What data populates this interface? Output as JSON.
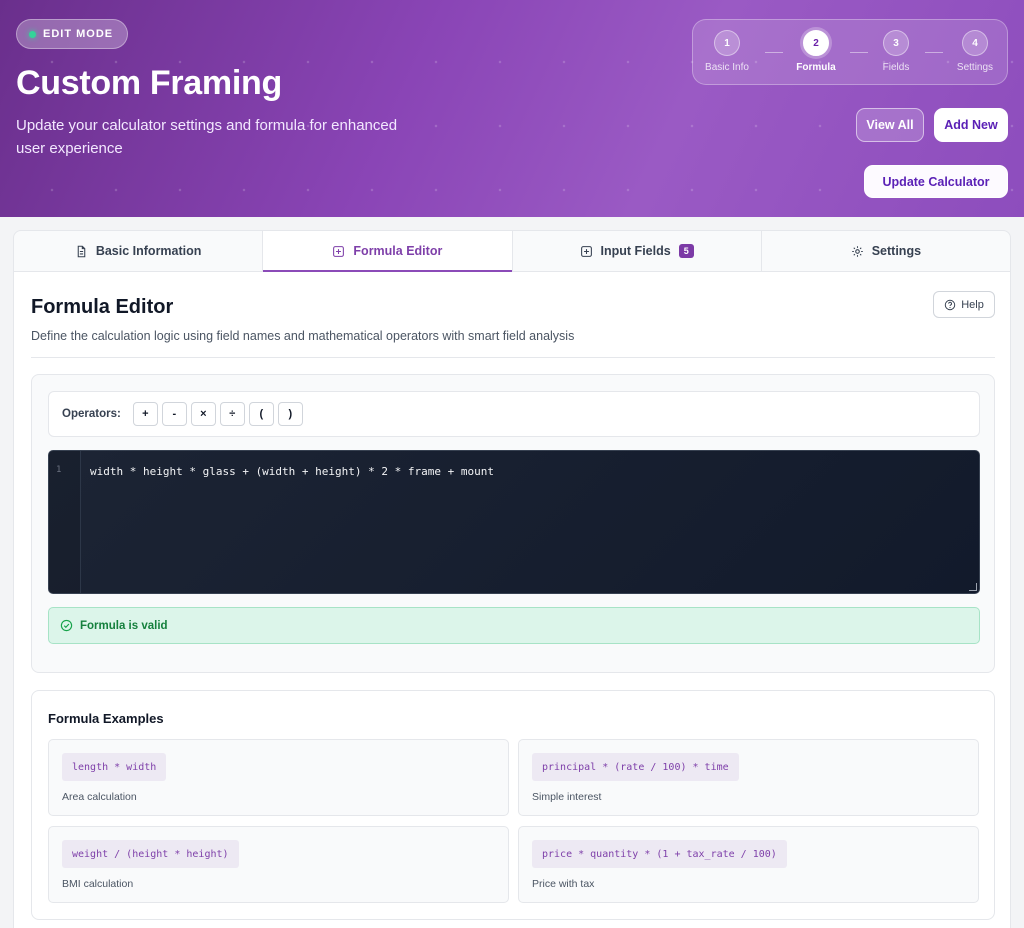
{
  "hero": {
    "badge": "EDIT MODE",
    "title": "Custom Framing",
    "subtitle": "Update your calculator settings and formula for enhanced user experience",
    "steps": [
      {
        "num": "1",
        "label": "Basic Info"
      },
      {
        "num": "2",
        "label": "Formula"
      },
      {
        "num": "3",
        "label": "Fields"
      },
      {
        "num": "4",
        "label": "Settings"
      }
    ],
    "active_step": 2,
    "view_all": "View All",
    "add_new": "Add New",
    "update": "Update Calculator"
  },
  "tabs": [
    {
      "label": "Basic Information",
      "icon": "document-icon"
    },
    {
      "label": "Formula Editor",
      "icon": "plus-square-icon"
    },
    {
      "label": "Input Fields",
      "icon": "plus-square-icon",
      "count": "5"
    },
    {
      "label": "Settings",
      "icon": "gear-icon"
    }
  ],
  "active_tab": 1,
  "panel": {
    "title": "Formula Editor",
    "description": "Define the calculation logic using field names and mathematical operators with smart field analysis",
    "help": "Help",
    "operators_label": "Operators:",
    "operators": [
      "+",
      "-",
      "×",
      "÷",
      "(",
      ")"
    ],
    "line_number": "1",
    "formula": "width * height * glass + (width + height) * 2 * frame + mount",
    "validation": "Formula is valid",
    "examples_title": "Formula Examples",
    "examples": [
      {
        "code": "length * width",
        "desc": "Area calculation"
      },
      {
        "code": "principal * (rate / 100) * time",
        "desc": "Simple interest"
      },
      {
        "code": "weight / (height * height)",
        "desc": "BMI calculation"
      },
      {
        "code": "price * quantity * (1 + tax_rate / 100)",
        "desc": "Price with tax"
      }
    ]
  },
  "colors": {
    "accent": "#7e3fa9",
    "success": "#15803d",
    "hero_gradient_start": "#6a2f8c",
    "hero_gradient_end": "#9a5ac4"
  }
}
